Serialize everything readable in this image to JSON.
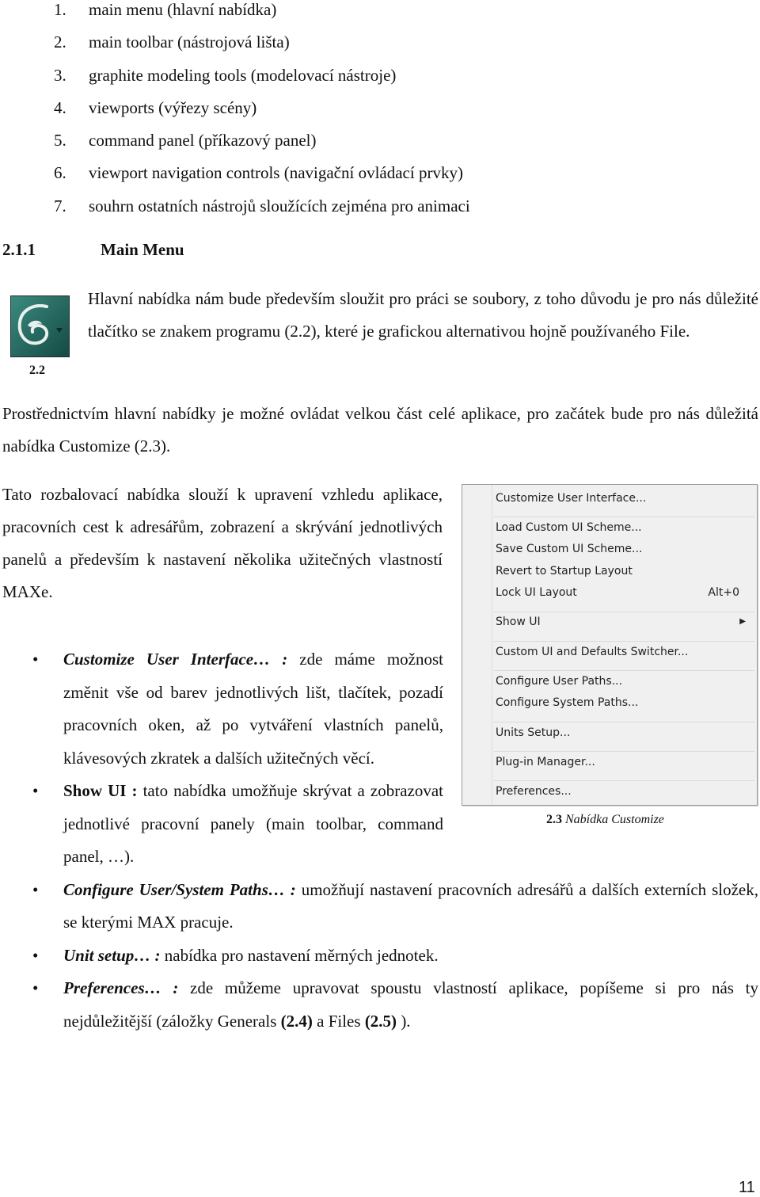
{
  "intro_list": [
    {
      "num": "1.",
      "text": "main menu (hlavní nabídka)"
    },
    {
      "num": "2.",
      "text": "main toolbar (nástrojová lišta)"
    },
    {
      "num": "3.",
      "text": "graphite modeling tools (modelovací nástroje)"
    },
    {
      "num": "4.",
      "text": "viewports (výřezy scény)"
    },
    {
      "num": "5.",
      "text": "command panel (příkazový panel)"
    },
    {
      "num": "6.",
      "text": "viewport navigation controls (navigační ovládací prvky)"
    },
    {
      "num": "7.",
      "text": "souhrn ostatních nástrojů sloužících zejména pro animaci"
    }
  ],
  "section": {
    "number": "2.1.1",
    "title": "Main Menu"
  },
  "figure_2_2": {
    "caption": "2.2",
    "icon": "3ds-max-logo-icon",
    "bg_color": "#1f5f57"
  },
  "paragraphs": [
    "Hlavní nabídka nám bude především sloužit pro práci se soubory, z toho důvodu je pro nás důležité tlačítko se znakem programu (2.2), které je grafickou alternativou hojně používaného File.",
    "Prostřednictvím hlavní nabídky je možné ovládat velkou část celé aplikace, pro začátek bude pro nás důležitá nabídka Customize (2.3).",
    "Tato rozbalovací nabídka slouží k upravení vzhledu aplikace, pracovních cest k adresářům, zobrazení a skrývání jednotlivých panelů a především k nastavení několika užitečných vlastností MAXe."
  ],
  "customize_menu": {
    "items": [
      {
        "label": "Customize User Interface..."
      },
      {
        "label": "Load Custom UI Scheme..."
      },
      {
        "label": "Save Custom UI Scheme..."
      },
      {
        "label": "Revert to Startup Layout"
      },
      {
        "label": "Lock UI Layout",
        "shortcut": "Alt+0"
      },
      {
        "label": "Show UI",
        "submenu_icon": "triangle-right-icon"
      },
      {
        "label": "Custom UI and Defaults Switcher..."
      },
      {
        "label": "Configure User Paths..."
      },
      {
        "label": "Configure System Paths..."
      },
      {
        "label": "Units Setup..."
      },
      {
        "label": "Plug-in Manager..."
      },
      {
        "label": "Preferences..."
      }
    ],
    "caption_num": "2.3",
    "caption_text": "Nabídka Customize"
  },
  "bullets": [
    {
      "term": "Customize User Interface… :",
      "text": " zde máme možnost změnit vše od barev jednotlivých lišt, tlačítek, pozadí pracovních oken, až po vytváření vlastních panelů, klávesových zkratek a dalších užitečných věcí."
    },
    {
      "term": "Show UI :",
      "text": " tato nabídka umožňuje skrývat a zobrazovat jednotlivé pracovní panely (main toolbar, command panel, …)."
    },
    {
      "term": "Configure User/System Paths… :",
      "text": " umožňují nastavení pracovních adresářů a dalších externích složek, se kterými MAX pracuje."
    },
    {
      "term": "Unit setup… :",
      "text": " nabídka pro nastavení měrných jednotek."
    },
    {
      "term": "Preferences… :",
      "text_before": " zde můžeme upravovat spoustu vlastností aplikace, popíšeme si pro nás ty nejdůležitější (záložky Generals ",
      "ref1": "(2.4)",
      "mid": " a Files ",
      "ref2": "(2.5)",
      "end": " )."
    }
  ],
  "page_number": "11"
}
